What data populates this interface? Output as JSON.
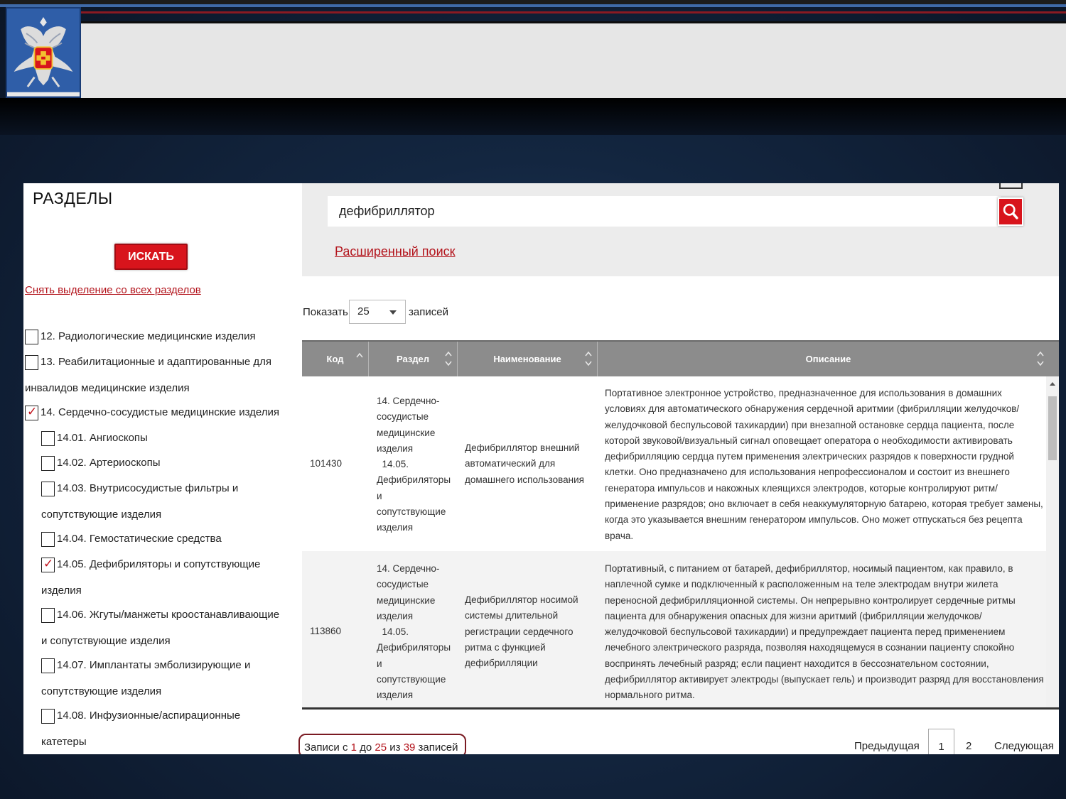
{
  "sidebar": {
    "title": "РАЗДЕЛЫ",
    "search_button": "ИСКАТЬ",
    "clear_link": "Снять выделение со всех разделов",
    "sections": [
      {
        "label": "12. Радиологические медицинские изделия",
        "checked": false
      },
      {
        "label": "13. Реабилитационные и адаптированные для",
        "cont": "инвалидов медицинские изделия",
        "checked": false
      },
      {
        "label": "14. Сердечно-сосудистые медицинские изделия",
        "checked": true
      },
      {
        "label": "14.01. Ангиоскопы",
        "checked": false
      },
      {
        "label": "14.02. Артериоскопы",
        "checked": false
      },
      {
        "label": "14.03. Внутрисосудистые фильтры и",
        "cont": "сопутствующие изделия",
        "checked": false
      },
      {
        "label": "14.04. Гемостатические средства",
        "checked": false
      },
      {
        "label": "14.05. Дефибриляторы и сопутствующие",
        "cont": "изделия",
        "checked": true
      },
      {
        "label": "14.06. Жгуты/манжеты кроостанавливающие",
        "cont": "и сопутствующие изделия",
        "checked": false
      },
      {
        "label": "14.07. Имплантаты эмболизирующие и",
        "cont": "сопутствующие изделия",
        "checked": false
      },
      {
        "label": "14.08. Инфузионные/аспирационные",
        "cont": "катетеры",
        "checked": false
      }
    ]
  },
  "search": {
    "query": "дефибриллятор",
    "advanced_link": "Расширенный поиск"
  },
  "length": {
    "prefix": "Показать",
    "value": "25",
    "suffix": "записей"
  },
  "table": {
    "columns": [
      "Код",
      "Раздел",
      "Наименование",
      "Описание"
    ],
    "rows": [
      {
        "code": "101430",
        "section": [
          "14. Сердечно-",
          "сосудистые",
          "медицинские",
          "изделия",
          "  14.05.",
          "Дефибриляторы",
          "и",
          "сопутствующие",
          "изделия"
        ],
        "name": [
          "Дефибриллятор внешний",
          "автоматический для",
          "домашнего использования"
        ],
        "description": [
          "Портативное электронное устройство, предназначенное для использования в домашних",
          "условиях для автоматического обнаружения сердечной аритмии (фибрилляции желудочков/",
          "желудочковой беспульсовой тахикардии) при внезапной остановке сердца пациента, после",
          "которой звуковой/визуальный сигнал оповещает оператора о необходимости активировать",
          "дефибрилляцию сердца путем применения электрических разрядов к поверхности грудной",
          "клетки. Оно предназначено для использования непрофессионалом и состоит из внешнего",
          "генератора импульсов и накожных клеящихся электродов, которые контролируют ритм/",
          "применение разрядов; оно включает в себя неаккумуляторную батарею, которая требует замены,",
          "когда это указывается внешним генератором импульсов. Оно может отпускаться без рецепта",
          "врача."
        ]
      },
      {
        "code": "113860",
        "section": [
          "14. Сердечно-",
          "сосудистые",
          "медицинские",
          "изделия",
          "  14.05.",
          "Дефибриляторы",
          "и",
          "сопутствующие",
          "изделия"
        ],
        "name": [
          "Дефибриллятор носимой",
          "системы длительной",
          "регистрации сердечного",
          "ритма с функцией",
          "дефибрилляции"
        ],
        "description": [
          "Портативный, с питанием от батарей, дефибриллятор, носимый пациентом, как правило, в",
          "наплечной сумке и подключенный к расположенным на теле электродам внутри жилета",
          "переносной дефибрилляционной системы. Он непрерывно контролирует сердечные ритмы",
          "пациента для обнаружения опасных для жизни аритмий (фибрилляции желудочков/",
          "желудочковой беспульсовой тахикардии) и предупреждает пациента перед применением",
          "лечебного электрического разряда, позволяя находящемуся в сознании пациенту спокойно",
          "воспринять лечебный разряд; если пациент находится в бессознательном состоянии,",
          "дефибриллятор активирует электроды (выпускает гель) и производит разряд для восстановления",
          "нормального ритма."
        ]
      }
    ]
  },
  "footer": {
    "info_prefix": "Записи с ",
    "info_from": "1",
    "info_mid1": " до ",
    "info_to": "25",
    "info_mid2": " из ",
    "info_total": "39",
    "info_suffix": " записей",
    "prev": "Предыдущая",
    "page1": "1",
    "page2": "2",
    "next": "Следующая"
  },
  "colors": {
    "accent_red": "#d8141c",
    "link_red": "#b3141c",
    "header_gray": "#8c8c8c"
  }
}
